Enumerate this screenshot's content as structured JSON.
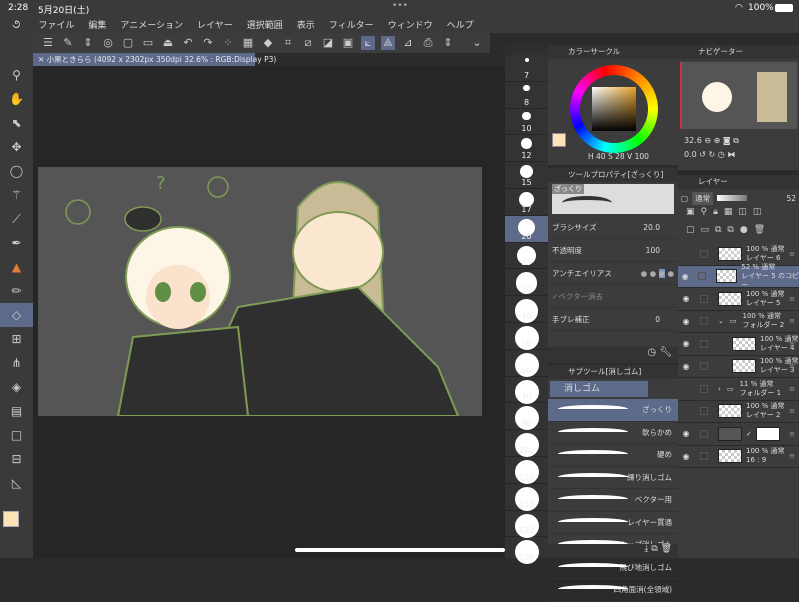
{
  "status": {
    "time": "2:28",
    "date": "5月20日(土)",
    "battery": "100%",
    "dots": "•••"
  },
  "menu": [
    "ファイル",
    "編集",
    "アニメーション",
    "レイヤー",
    "選択範囲",
    "表示",
    "フィルター",
    "ウィンドウ",
    "ヘルプ"
  ],
  "document_tab": "小黒ときらら (4092 x 2302px 350dpi 32.6% : RGB:Display P3)",
  "brush_sizes": [
    "7",
    "8",
    "10",
    "12",
    "15",
    "17",
    "20",
    "25",
    "30",
    "40",
    "50",
    "60",
    "70",
    "80",
    "100",
    "120",
    "150",
    "170",
    "200"
  ],
  "brush_selected": "20",
  "color_circle": {
    "title": "カラーサークル",
    "h": "40",
    "s": "28",
    "v": "100",
    "main_color": "#fde4b8",
    "sub_color": "#ffffff"
  },
  "tool_property": {
    "title": "ツールプロパティ[ざっくり]",
    "preset": "ざっくり",
    "brush_size_label": "ブラシサイズ",
    "brush_size": "20.0",
    "opacity_label": "不透明度",
    "opacity": "100",
    "antialias_label": "アンチエイリアス",
    "vector_erase_label": "ベクター消去",
    "stabilization_label": "手ブレ補正",
    "stabilization": "0"
  },
  "subtool": {
    "title": "サブツール[消しゴム]",
    "group": "消しゴム",
    "items": [
      "ざっくり",
      "軟らかめ",
      "硬め",
      "練り消しゴム",
      "ベクター用",
      "レイヤー貫通",
      "スナップ消しゴム",
      "飛び地消しゴム",
      "四角面消(全領域)"
    ],
    "selected": "ざっくり"
  },
  "navigator": {
    "title": "ナビゲーター",
    "zoom": "32.6",
    "rotation": "0.0"
  },
  "layer_panel": {
    "title": "レイヤー",
    "blend": "通常",
    "opacity": "52",
    "layers": [
      {
        "pct": "100 %",
        "mode": "通常",
        "name": "レイヤー 6",
        "visible": false,
        "indent": 0
      },
      {
        "pct": "52 %",
        "mode": "通常",
        "name": "レイヤー 5 のコピー",
        "visible": true,
        "indent": 0,
        "selected": true
      },
      {
        "pct": "100 %",
        "mode": "通常",
        "name": "レイヤー 5",
        "visible": true,
        "indent": 0
      },
      {
        "pct": "100 %",
        "mode": "通常",
        "name": "フォルダー 2",
        "visible": true,
        "indent": 0,
        "folder": true,
        "open": true
      },
      {
        "pct": "100 %",
        "mode": "通常",
        "name": "レイヤー 4",
        "visible": true,
        "indent": 1
      },
      {
        "pct": "100 %",
        "mode": "通常",
        "name": "レイヤー 3",
        "visible": true,
        "indent": 1
      },
      {
        "pct": "11 %",
        "mode": "通常",
        "name": "フォルダー 1",
        "visible": false,
        "indent": 0,
        "folder": true
      },
      {
        "pct": "100 %",
        "mode": "通常",
        "name": "レイヤー 2",
        "visible": false,
        "indent": 0
      },
      {
        "pct": "",
        "mode": "",
        "name": "",
        "visible": true,
        "indent": 0,
        "paper": true
      },
      {
        "pct": "100 %",
        "mode": "通常",
        "name": "16 : 9",
        "visible": true,
        "indent": 0
      }
    ]
  }
}
